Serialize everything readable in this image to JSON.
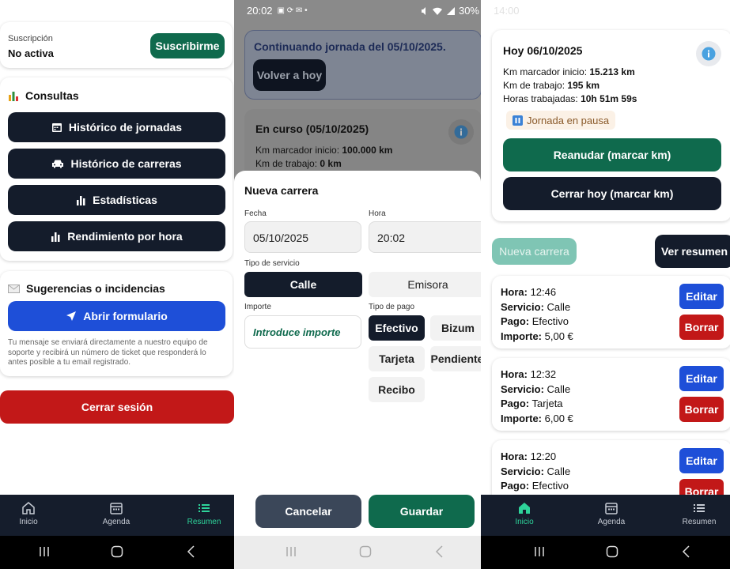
{
  "left": {
    "subscription": {
      "label": "Suscripción",
      "status": "No activa",
      "button": "Suscribirme"
    },
    "consultas": {
      "title": "Consultas",
      "buttons": [
        "Histórico de jornadas",
        "Histórico de carreras",
        "Estadísticas",
        "Rendimiento por hora"
      ]
    },
    "suggestions": {
      "title": "Sugerencias o incidencias",
      "button": "Abrir formulario",
      "note": [
        "Tu mensaje se enviará directamente a nuestro equipo de",
        "soporte y recibirá un número de ticket que responderá lo",
        "antes posible a tu email registrado."
      ]
    },
    "logout": "Cerrar sesión",
    "nav": [
      {
        "label": "Inicio",
        "icon": "home-icon"
      },
      {
        "label": "Agenda",
        "icon": "calendar-icon"
      },
      {
        "label": "Resumen",
        "icon": "list-icon"
      }
    ],
    "active_nav": "Resumen"
  },
  "middle": {
    "statusbar": {
      "time": "20:02",
      "battery": "30%"
    },
    "continuing": {
      "text": "Continuando jornada del 05/10/2025.",
      "button": "Volver a hoy"
    },
    "current": {
      "title": "En curso (05/10/2025)",
      "km_start_label": "Km marcador inicio:",
      "km_start_value": "100.000 km",
      "km_work_label": "Km de trabajo:",
      "km_work_value": "0 km"
    },
    "sheet": {
      "title": "Nueva carrera",
      "fecha_label": "Fecha",
      "fecha_value": "05/10/2025",
      "hora_label": "Hora",
      "hora_value": "20:02",
      "service_label": "Tipo de servicio",
      "service_options": [
        "Calle",
        "Emisora"
      ],
      "service_selected": "Calle",
      "importe_label": "Importe",
      "importe_placeholder": "Introduce importe",
      "payment_label": "Tipo de pago",
      "payment_options": [
        "Efectivo",
        "Bizum",
        "Tarjeta",
        "Pendiente",
        "Recibo"
      ],
      "payment_selected": "Efectivo",
      "cancel": "Cancelar",
      "save": "Guardar"
    }
  },
  "right": {
    "statusbar": {
      "time": "14:00"
    },
    "today": {
      "title": "Hoy 06/10/2025",
      "km_start_label": "Km marcador inicio:",
      "km_start_value": "15.213 km",
      "km_work_label": "Km de trabajo:",
      "km_work_value": "195 km",
      "hours_label": "Horas trabajadas:",
      "hours_value": "10h 51m 59s",
      "paused": "Jornada en pausa",
      "resume": "Reanudar (marcar km)",
      "close": "Cerrar hoy (marcar km)"
    },
    "new_ride": "Nueva carrera",
    "summary": "Ver resumen",
    "rides": [
      {
        "hora": "12:46",
        "servicio": "Calle",
        "pago": "Efectivo",
        "importe": "5,00 €"
      },
      {
        "hora": "12:32",
        "servicio": "Calle",
        "pago": "Tarjeta",
        "importe": "6,00 €"
      },
      {
        "hora": "12:20",
        "servicio": "Calle",
        "pago": "Efectivo",
        "importe": ""
      }
    ],
    "ride_labels": {
      "hora": "Hora:",
      "servicio": "Servicio:",
      "pago": "Pago:",
      "importe": "Importe:"
    },
    "edit": "Editar",
    "delete": "Borrar",
    "nav": [
      {
        "label": "Inicio",
        "icon": "home-icon"
      },
      {
        "label": "Agenda",
        "icon": "calendar-icon"
      },
      {
        "label": "Resumen",
        "icon": "list-icon"
      }
    ],
    "active_nav": "Inicio"
  },
  "colors": {
    "dark": "#141c2b",
    "green": "#0f6a4d",
    "red": "#c21818",
    "blue": "#1e4fd8",
    "nav_active": "#2ed39a"
  }
}
